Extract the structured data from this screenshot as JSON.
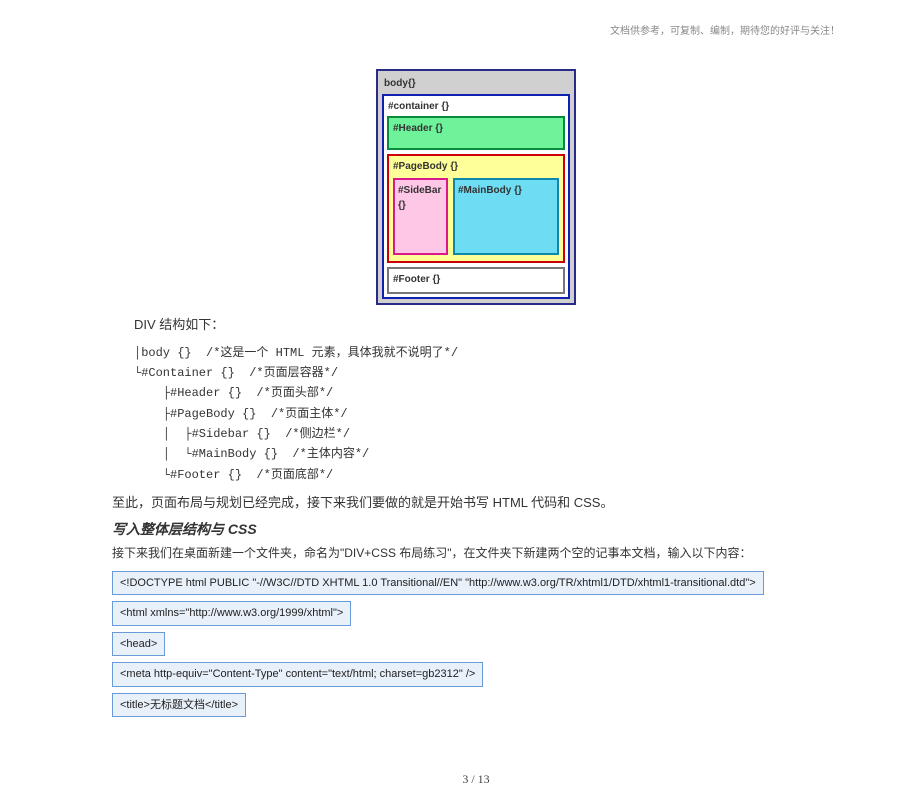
{
  "headerNote": "文档供参考，可复制、编制，期待您的好评与关注！",
  "diagram": {
    "body": "body{}",
    "container": "#container {}",
    "header": "#Header {}",
    "pagebody": "#PageBody {}",
    "sidebar": "#SideBar {}",
    "mainbody": "#MainBody {}",
    "footer": "#Footer {}"
  },
  "structureTitle": "DIV 结构如下：",
  "structure": "│body {}  /*这是一个 HTML 元素，具体我就不说明了*/\n└#Container {}  /*页面层容器*/\n    ├#Header {}  /*页面头部*/\n    ├#PageBody {}  /*页面主体*/\n    │  ├#Sidebar {}  /*侧边栏*/\n    │  └#MainBody {}  /*主体内容*/\n    └#Footer {}  /*页面底部*/",
  "para1": "至此，页面布局与规划已经完成，接下来我们要做的就是开始书写 HTML 代码和 CSS。",
  "heading": "写入整体层结构与 CSS",
  "para2": "接下来我们在桌面新建一个文件夹，命名为\"DIV+CSS 布局练习\"，在文件夹下新建两个空的记事本文档，输入以下内容：",
  "codeLines": [
    "<!DOCTYPE html PUBLIC \"-//W3C//DTD XHTML 1.0 Transitional//EN\" \"http://www.w3.org/TR/xhtml1/DTD/xhtml1-transitional.dtd\">",
    "<html xmlns=\"http://www.w3.org/1999/xhtml\">",
    "<head>",
    "<meta http-equiv=\"Content-Type\" content=\"text/html; charset=gb2312\" />",
    "<title>无标题文档</title>"
  ],
  "pageFooter": "3 / 13"
}
